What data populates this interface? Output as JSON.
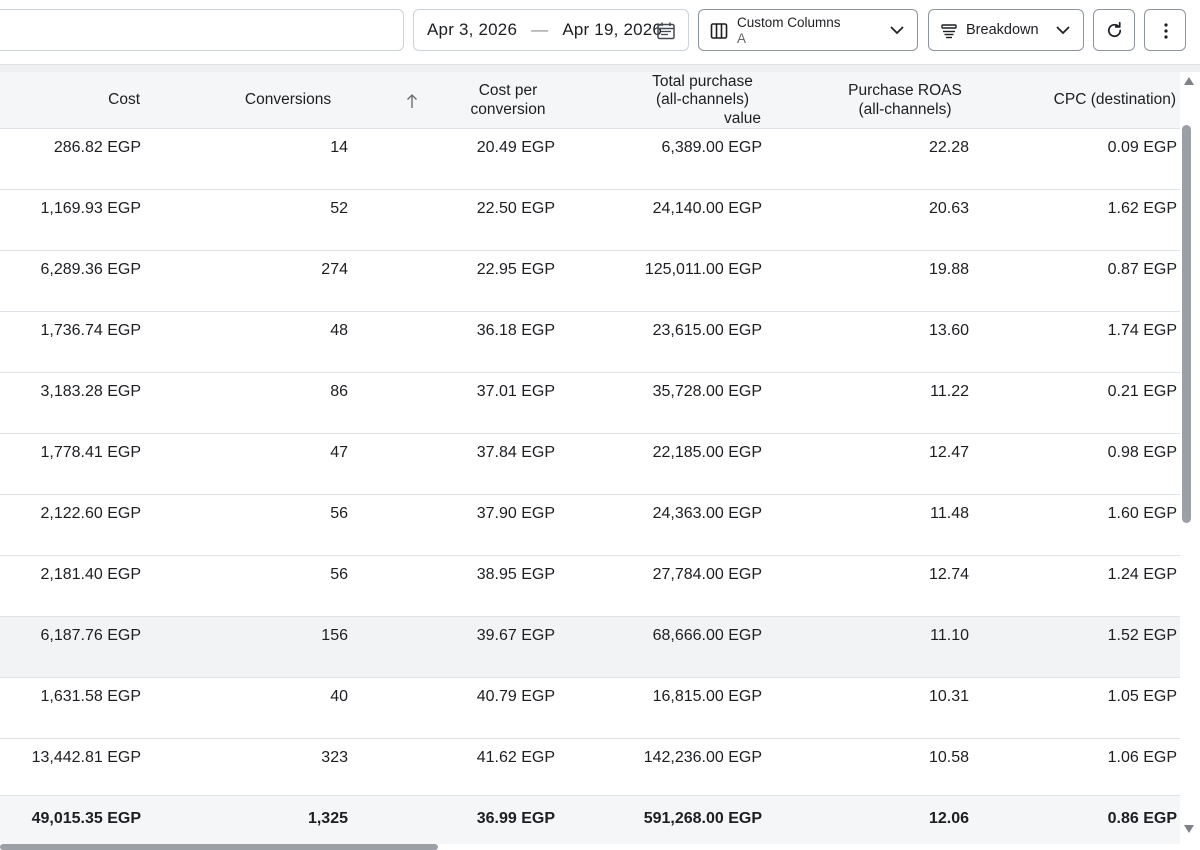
{
  "toolbar": {
    "search_value": "",
    "date_start": "Apr 3, 2026",
    "date_separator": "—",
    "date_end": "Apr 19, 2026",
    "columns_label": "Custom Columns",
    "columns_preset": "A",
    "breakdown_label": "Breakdown"
  },
  "table": {
    "columns": [
      {
        "key": "cost",
        "label_lines": [
          "Cost"
        ]
      },
      {
        "key": "conversions",
        "label_lines": [
          "Conversions"
        ],
        "sorted": "ascending"
      },
      {
        "key": "cost_per_conversion",
        "label_lines": [
          "Cost per",
          "conversion"
        ]
      },
      {
        "key": "total_purchase_value",
        "label_lines": [
          "Total purchase",
          "(all-channels)",
          "value"
        ]
      },
      {
        "key": "purchase_roas",
        "label_lines": [
          "Purchase ROAS",
          "(all-channels)"
        ]
      },
      {
        "key": "cpc_destination",
        "label_lines": [
          "CPC (destination)"
        ]
      }
    ],
    "rows": [
      {
        "cost": "286.82 EGP",
        "conversions": "14",
        "cost_per_conversion": "20.49 EGP",
        "total_purchase_value": "6,389.00 EGP",
        "purchase_roas": "22.28",
        "cpc_destination": "0.09 EGP"
      },
      {
        "cost": "1,169.93 EGP",
        "conversions": "52",
        "cost_per_conversion": "22.50 EGP",
        "total_purchase_value": "24,140.00 EGP",
        "purchase_roas": "20.63",
        "cpc_destination": "1.62 EGP"
      },
      {
        "cost": "6,289.36 EGP",
        "conversions": "274",
        "cost_per_conversion": "22.95 EGP",
        "total_purchase_value": "125,011.00 EGP",
        "purchase_roas": "19.88",
        "cpc_destination": "0.87 EGP"
      },
      {
        "cost": "1,736.74 EGP",
        "conversions": "48",
        "cost_per_conversion": "36.18 EGP",
        "total_purchase_value": "23,615.00 EGP",
        "purchase_roas": "13.60",
        "cpc_destination": "1.74 EGP"
      },
      {
        "cost": "3,183.28 EGP",
        "conversions": "86",
        "cost_per_conversion": "37.01 EGP",
        "total_purchase_value": "35,728.00 EGP",
        "purchase_roas": "11.22",
        "cpc_destination": "0.21 EGP"
      },
      {
        "cost": "1,778.41 EGP",
        "conversions": "47",
        "cost_per_conversion": "37.84 EGP",
        "total_purchase_value": "22,185.00 EGP",
        "purchase_roas": "12.47",
        "cpc_destination": "0.98 EGP"
      },
      {
        "cost": "2,122.60 EGP",
        "conversions": "56",
        "cost_per_conversion": "37.90 EGP",
        "total_purchase_value": "24,363.00 EGP",
        "purchase_roas": "11.48",
        "cpc_destination": "1.60 EGP"
      },
      {
        "cost": "2,181.40 EGP",
        "conversions": "56",
        "cost_per_conversion": "38.95 EGP",
        "total_purchase_value": "27,784.00 EGP",
        "purchase_roas": "12.74",
        "cpc_destination": "1.24 EGP"
      },
      {
        "cost": "6,187.76 EGP",
        "conversions": "156",
        "cost_per_conversion": "39.67 EGP",
        "total_purchase_value": "68,666.00 EGP",
        "purchase_roas": "11.10",
        "cpc_destination": "1.52 EGP",
        "highlighted": true
      },
      {
        "cost": "1,631.58 EGP",
        "conversions": "40",
        "cost_per_conversion": "40.79 EGP",
        "total_purchase_value": "16,815.00 EGP",
        "purchase_roas": "10.31",
        "cpc_destination": "1.05 EGP"
      },
      {
        "cost": "13,442.81 EGP",
        "conversions": "323",
        "cost_per_conversion": "41.62 EGP",
        "total_purchase_value": "142,236.00 EGP",
        "purchase_roas": "10.58",
        "cpc_destination": "1.06 EGP"
      }
    ],
    "totals": {
      "cost": "49,015.35 EGP",
      "conversions": "1,325",
      "cost_per_conversion": "36.99 EGP",
      "total_purchase_value": "591,268.00 EGP",
      "purchase_roas": "12.06",
      "cpc_destination": "0.86 EGP"
    }
  },
  "icons": {
    "calendar": "calendar-icon",
    "columns": "columns-icon",
    "breakdown": "breakdown-icon",
    "refresh": "refresh-icon",
    "more": "more-vertical-icon",
    "sort": "sort-ascending-arrow-icon"
  },
  "colors": {
    "text": "#1c1e21",
    "border": "#cbd2d9",
    "header_bg": "#f5f6f7",
    "row_highlight": "#f2f3f4",
    "scrollbar": "#9aa0a6"
  }
}
